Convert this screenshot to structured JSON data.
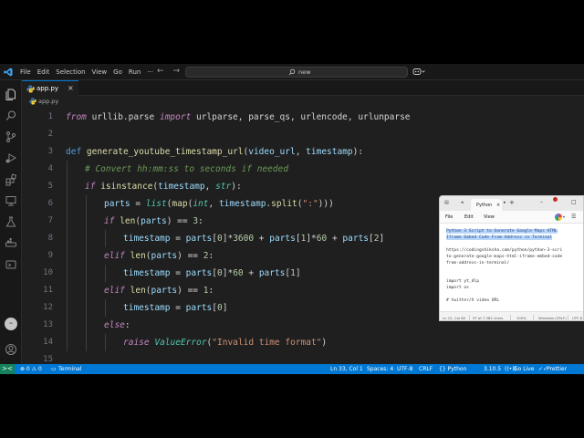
{
  "titlebar": {
    "menu": [
      "File",
      "Edit",
      "Selection",
      "View",
      "Go",
      "Run"
    ],
    "more": "···",
    "back": "←",
    "forward": "→",
    "search_text": "new"
  },
  "tab": {
    "name": "app.py",
    "close": "×"
  },
  "breadcrumb": "app.py",
  "editor": {
    "lines": [
      {
        "n": "1",
        "indent": 0,
        "tokens": [
          {
            "t": "from",
            "c": "kw-i"
          },
          {
            "t": " urllib.parse ",
            "c": "plain"
          },
          {
            "t": "import",
            "c": "kw-i"
          },
          {
            "t": " urlparse, parse_qs, urlencode, urlunparse",
            "c": "plain"
          }
        ]
      },
      {
        "n": "2",
        "indent": 0,
        "tokens": []
      },
      {
        "n": "3",
        "indent": 0,
        "tokens": [
          {
            "t": "def",
            "c": "def"
          },
          {
            "t": " ",
            "c": "plain"
          },
          {
            "t": "generate_youtube_timestamp_url",
            "c": "fn"
          },
          {
            "t": "(",
            "c": "plain"
          },
          {
            "t": "video_url",
            "c": "var"
          },
          {
            "t": ", ",
            "c": "plain"
          },
          {
            "t": "timestamp",
            "c": "var"
          },
          {
            "t": "):",
            "c": "plain"
          }
        ]
      },
      {
        "n": "4",
        "indent": 1,
        "tokens": [
          {
            "t": "# Convert hh:mm:ss to seconds if needed",
            "c": "cmt"
          }
        ]
      },
      {
        "n": "5",
        "indent": 1,
        "tokens": [
          {
            "t": "if",
            "c": "kw-i"
          },
          {
            "t": " ",
            "c": "plain"
          },
          {
            "t": "isinstance",
            "c": "fn"
          },
          {
            "t": "(",
            "c": "plain"
          },
          {
            "t": "timestamp",
            "c": "var"
          },
          {
            "t": ", ",
            "c": "plain"
          },
          {
            "t": "str",
            "c": "bi"
          },
          {
            "t": "):",
            "c": "plain"
          }
        ]
      },
      {
        "n": "6",
        "indent": 2,
        "tokens": [
          {
            "t": "parts",
            "c": "var"
          },
          {
            "t": " = ",
            "c": "plain"
          },
          {
            "t": "list",
            "c": "bi"
          },
          {
            "t": "(",
            "c": "plain"
          },
          {
            "t": "map",
            "c": "fn"
          },
          {
            "t": "(",
            "c": "plain"
          },
          {
            "t": "int",
            "c": "bi"
          },
          {
            "t": ", ",
            "c": "plain"
          },
          {
            "t": "timestamp",
            "c": "var"
          },
          {
            "t": ".",
            "c": "plain"
          },
          {
            "t": "split",
            "c": "fn"
          },
          {
            "t": "(",
            "c": "plain"
          },
          {
            "t": "\":\"",
            "c": "str"
          },
          {
            "t": ")))",
            "c": "plain"
          }
        ]
      },
      {
        "n": "7",
        "indent": 2,
        "tokens": [
          {
            "t": "if",
            "c": "kw-i"
          },
          {
            "t": " ",
            "c": "plain"
          },
          {
            "t": "len",
            "c": "fn"
          },
          {
            "t": "(",
            "c": "plain"
          },
          {
            "t": "parts",
            "c": "var"
          },
          {
            "t": ") == ",
            "c": "plain"
          },
          {
            "t": "3",
            "c": "num"
          },
          {
            "t": ":",
            "c": "plain"
          }
        ]
      },
      {
        "n": "8",
        "indent": 3,
        "tokens": [
          {
            "t": "timestamp",
            "c": "var"
          },
          {
            "t": " = ",
            "c": "plain"
          },
          {
            "t": "parts",
            "c": "var"
          },
          {
            "t": "[",
            "c": "plain"
          },
          {
            "t": "0",
            "c": "num"
          },
          {
            "t": "]*",
            "c": "plain"
          },
          {
            "t": "3600",
            "c": "num"
          },
          {
            "t": " + ",
            "c": "plain"
          },
          {
            "t": "parts",
            "c": "var"
          },
          {
            "t": "[",
            "c": "plain"
          },
          {
            "t": "1",
            "c": "num"
          },
          {
            "t": "]*",
            "c": "plain"
          },
          {
            "t": "60",
            "c": "num"
          },
          {
            "t": " + ",
            "c": "plain"
          },
          {
            "t": "parts",
            "c": "var"
          },
          {
            "t": "[",
            "c": "plain"
          },
          {
            "t": "2",
            "c": "num"
          },
          {
            "t": "]",
            "c": "plain"
          }
        ]
      },
      {
        "n": "9",
        "indent": 2,
        "tokens": [
          {
            "t": "elif",
            "c": "kw-i"
          },
          {
            "t": " ",
            "c": "plain"
          },
          {
            "t": "len",
            "c": "fn"
          },
          {
            "t": "(",
            "c": "plain"
          },
          {
            "t": "parts",
            "c": "var"
          },
          {
            "t": ") == ",
            "c": "plain"
          },
          {
            "t": "2",
            "c": "num"
          },
          {
            "t": ":",
            "c": "plain"
          }
        ]
      },
      {
        "n": "10",
        "indent": 3,
        "tokens": [
          {
            "t": "timestamp",
            "c": "var"
          },
          {
            "t": " = ",
            "c": "plain"
          },
          {
            "t": "parts",
            "c": "var"
          },
          {
            "t": "[",
            "c": "plain"
          },
          {
            "t": "0",
            "c": "num"
          },
          {
            "t": "]*",
            "c": "plain"
          },
          {
            "t": "60",
            "c": "num"
          },
          {
            "t": " + ",
            "c": "plain"
          },
          {
            "t": "parts",
            "c": "var"
          },
          {
            "t": "[",
            "c": "plain"
          },
          {
            "t": "1",
            "c": "num"
          },
          {
            "t": "]",
            "c": "plain"
          }
        ]
      },
      {
        "n": "11",
        "indent": 2,
        "tokens": [
          {
            "t": "elif",
            "c": "kw-i"
          },
          {
            "t": " ",
            "c": "plain"
          },
          {
            "t": "len",
            "c": "fn"
          },
          {
            "t": "(",
            "c": "plain"
          },
          {
            "t": "parts",
            "c": "var"
          },
          {
            "t": ") == ",
            "c": "plain"
          },
          {
            "t": "1",
            "c": "num"
          },
          {
            "t": ":",
            "c": "plain"
          }
        ]
      },
      {
        "n": "12",
        "indent": 3,
        "tokens": [
          {
            "t": "timestamp",
            "c": "var"
          },
          {
            "t": " = ",
            "c": "plain"
          },
          {
            "t": "parts",
            "c": "var"
          },
          {
            "t": "[",
            "c": "plain"
          },
          {
            "t": "0",
            "c": "num"
          },
          {
            "t": "]",
            "c": "plain"
          }
        ]
      },
      {
        "n": "13",
        "indent": 2,
        "tokens": [
          {
            "t": "else",
            "c": "kw-i"
          },
          {
            "t": ":",
            "c": "plain"
          }
        ]
      },
      {
        "n": "14",
        "indent": 3,
        "tokens": [
          {
            "t": "raise",
            "c": "kw-i"
          },
          {
            "t": " ",
            "c": "plain"
          },
          {
            "t": "ValueError",
            "c": "cls"
          },
          {
            "t": "(",
            "c": "plain"
          },
          {
            "t": "\"Invalid time format\"",
            "c": "str"
          },
          {
            "t": ")",
            "c": "plain"
          }
        ]
      },
      {
        "n": "15",
        "indent": 0,
        "tokens": []
      }
    ]
  },
  "statusbar": {
    "remote": "><",
    "problems": "⊗ 0  ⚠ 0",
    "terminal": "Terminal",
    "position": "Ln 33, Col 1",
    "spaces": "Spaces: 4",
    "encoding": "UTF-8",
    "eol": "CRLF",
    "language": "{} Python",
    "version": "3.10.5",
    "golive": "Go Live",
    "prettier": "Prettier"
  },
  "notepad": {
    "tab_title": "Python",
    "tab_close": "×",
    "new_tab": "+",
    "menu": [
      "File",
      "Edit",
      "View"
    ],
    "lines": [
      {
        "text": "Python 3 Script to Generate Google Maps HTML",
        "style": "sel"
      },
      {
        "text": "Iframe Embed Code From Address in Terminal",
        "style": "sel"
      },
      {
        "text": "",
        "style": ""
      },
      {
        "text": "https://codingshiksha.com/python/python-3-scri",
        "style": ""
      },
      {
        "text": "to-generate-google-maps-html-iframe-embed-code",
        "style": ""
      },
      {
        "text": "from-address-in-terminal/",
        "style": ""
      },
      {
        "text": "",
        "style": ""
      },
      {
        "text": "",
        "style": ""
      },
      {
        "text": "import yt_dlp",
        "style": ""
      },
      {
        "text": "import os",
        "style": ""
      },
      {
        "text": "",
        "style": ""
      },
      {
        "text": "# twitter/X video URL",
        "style": ""
      }
    ],
    "status": {
      "pos": "Ln 12, Col 80",
      "chars": "97 of 7,382 chars",
      "zoom": "100%",
      "eol": "Windows (CRLF)",
      "enc": "UTF-8"
    }
  }
}
